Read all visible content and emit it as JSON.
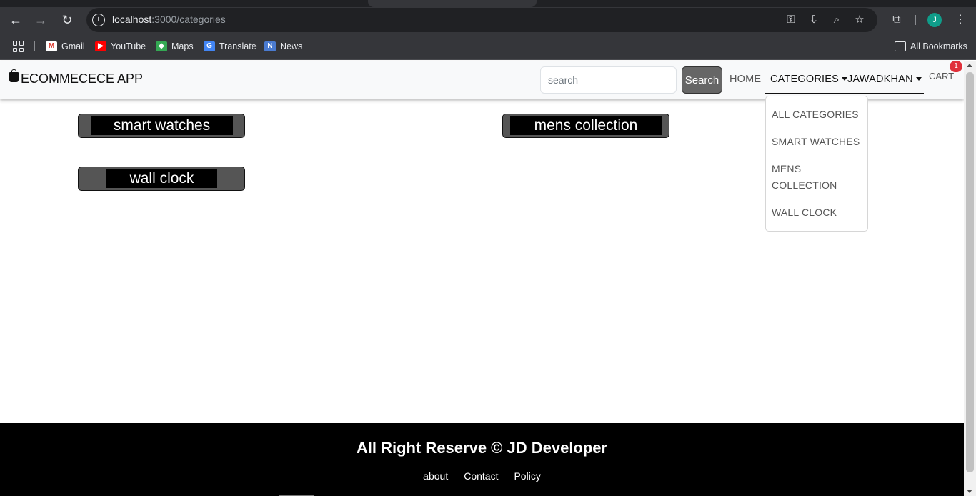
{
  "browser": {
    "url_host": "localhost",
    "url_path": ":3000/categories",
    "profile_initial": "J",
    "bookmarks": [
      {
        "label": "Gmail",
        "icon": "gmail-icon"
      },
      {
        "label": "YouTube",
        "icon": "youtube-icon"
      },
      {
        "label": "Maps",
        "icon": "maps-icon"
      },
      {
        "label": "Translate",
        "icon": "translate-icon"
      },
      {
        "label": "News",
        "icon": "news-icon"
      }
    ],
    "all_bookmarks": "All Bookmarks"
  },
  "navbar": {
    "brand": "ECOMMECECE APP",
    "search_placeholder": "search",
    "search_button": "Search",
    "home": "HOME",
    "categories": "CATEGORIES",
    "user": "JAWADKHAN",
    "cart": "CART",
    "cart_count": "1"
  },
  "dropdown": {
    "items": [
      "ALL CATEGORIES",
      "SMART WATCHES",
      "MENS",
      "COLLECTION",
      "WALL CLOCK"
    ]
  },
  "categories": [
    "smart watches",
    "mens collection",
    "wall clock"
  ],
  "footer": {
    "title": "All Right Reserve © JD Developer",
    "links": [
      "about",
      "Contact",
      "Policy"
    ]
  },
  "colors": {
    "chrome_bg": "#35363a",
    "badge": "#e0303a",
    "footer_bg": "#000000"
  }
}
